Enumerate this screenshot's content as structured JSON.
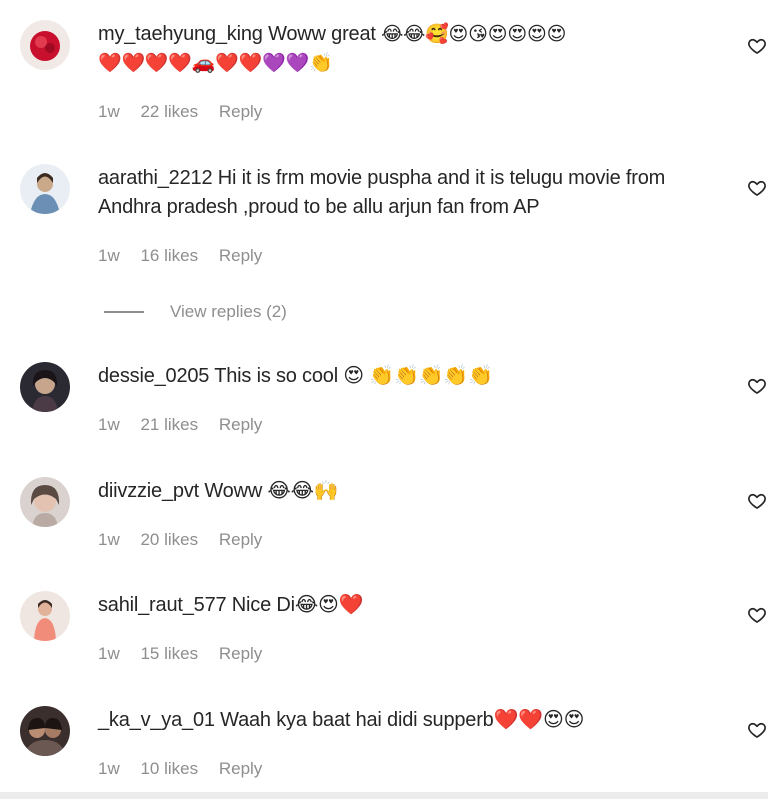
{
  "comments": [
    {
      "username": "my_taehyung_king",
      "text": "Woww great",
      "emojis_line1": "😂😂🥰😍😘😍😍😍😍",
      "emojis_line2": "❤️❤️❤️❤️🚗❤️❤️💜💜👏",
      "time": "1w",
      "likes": "22 likes",
      "reply": "Reply"
    },
    {
      "username": "aarathi_2212",
      "text": "Hi it is frm movie puspha and it is telugu movie from Andhra pradesh ,proud to be allu arjun fan from AP",
      "time": "1w",
      "likes": "16 likes",
      "reply": "Reply",
      "view_replies": "View replies (2)"
    },
    {
      "username": "dessie_0205",
      "text": "This is so cool 😍 👏👏👏👏👏",
      "time": "1w",
      "likes": "21 likes",
      "reply": "Reply"
    },
    {
      "username": "diivzzie_pvt",
      "text": "Woww 😂😂🙌",
      "time": "1w",
      "likes": "20 likes",
      "reply": "Reply"
    },
    {
      "username": "sahil_raut_577",
      "text": "Nice Di😂😍❤️",
      "time": "1w",
      "likes": "15 likes",
      "reply": "Reply"
    },
    {
      "username": "_ka_v_ya_01",
      "text": "Waah kya baat hai didi supperb❤️❤️😍😍",
      "time": "1w",
      "likes": "10 likes",
      "reply": "Reply"
    }
  ],
  "icons": {
    "like": "heart-outline-icon"
  },
  "colors": {
    "text": "#262626",
    "muted": "#8e8e8e"
  }
}
